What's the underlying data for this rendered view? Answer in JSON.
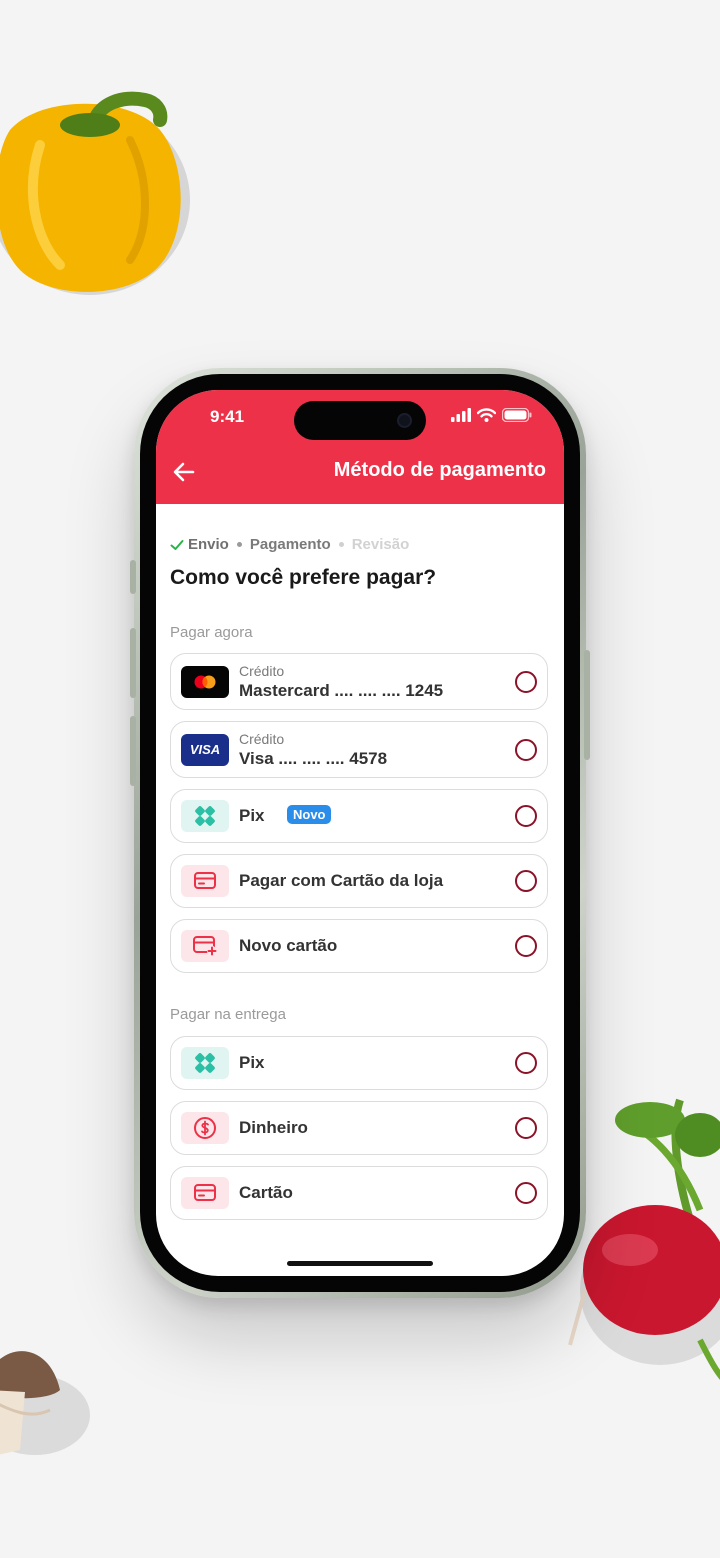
{
  "status_bar": {
    "time": "9:41"
  },
  "header": {
    "title": "Método de pagamento"
  },
  "stepper": {
    "steps": [
      {
        "label": "Envio",
        "state": "done"
      },
      {
        "label": "Pagamento",
        "state": "current"
      },
      {
        "label": "Revisão",
        "state": "upcoming"
      }
    ]
  },
  "question": "Como você prefere pagar?",
  "sections": {
    "pay_now": {
      "label": "Pagar agora",
      "options": [
        {
          "icon": "mastercard-icon",
          "sub": "Crédito",
          "label": "Mastercard .... .... .... 1245"
        },
        {
          "icon": "visa-icon",
          "icon_text": "VISA",
          "sub": "Crédito",
          "label": "Visa .... .... .... 4578"
        },
        {
          "icon": "pix-icon",
          "label": "Pix",
          "badge": "Novo"
        },
        {
          "icon": "card-icon",
          "label": "Pagar com Cartão da loja"
        },
        {
          "icon": "card-plus-icon",
          "label": "Novo cartão"
        }
      ]
    },
    "pay_on_delivery": {
      "label": "Pagar na entrega",
      "options": [
        {
          "icon": "pix-icon",
          "label": "Pix"
        },
        {
          "icon": "dollar-icon",
          "label": "Dinheiro"
        },
        {
          "icon": "card-icon",
          "label": "Cartão"
        }
      ]
    }
  },
  "colors": {
    "brand": "#ec3148",
    "radio": "#8b1328",
    "pix": "#2bbfa5",
    "badge": "#2a8de9",
    "success": "#2ab34a"
  }
}
